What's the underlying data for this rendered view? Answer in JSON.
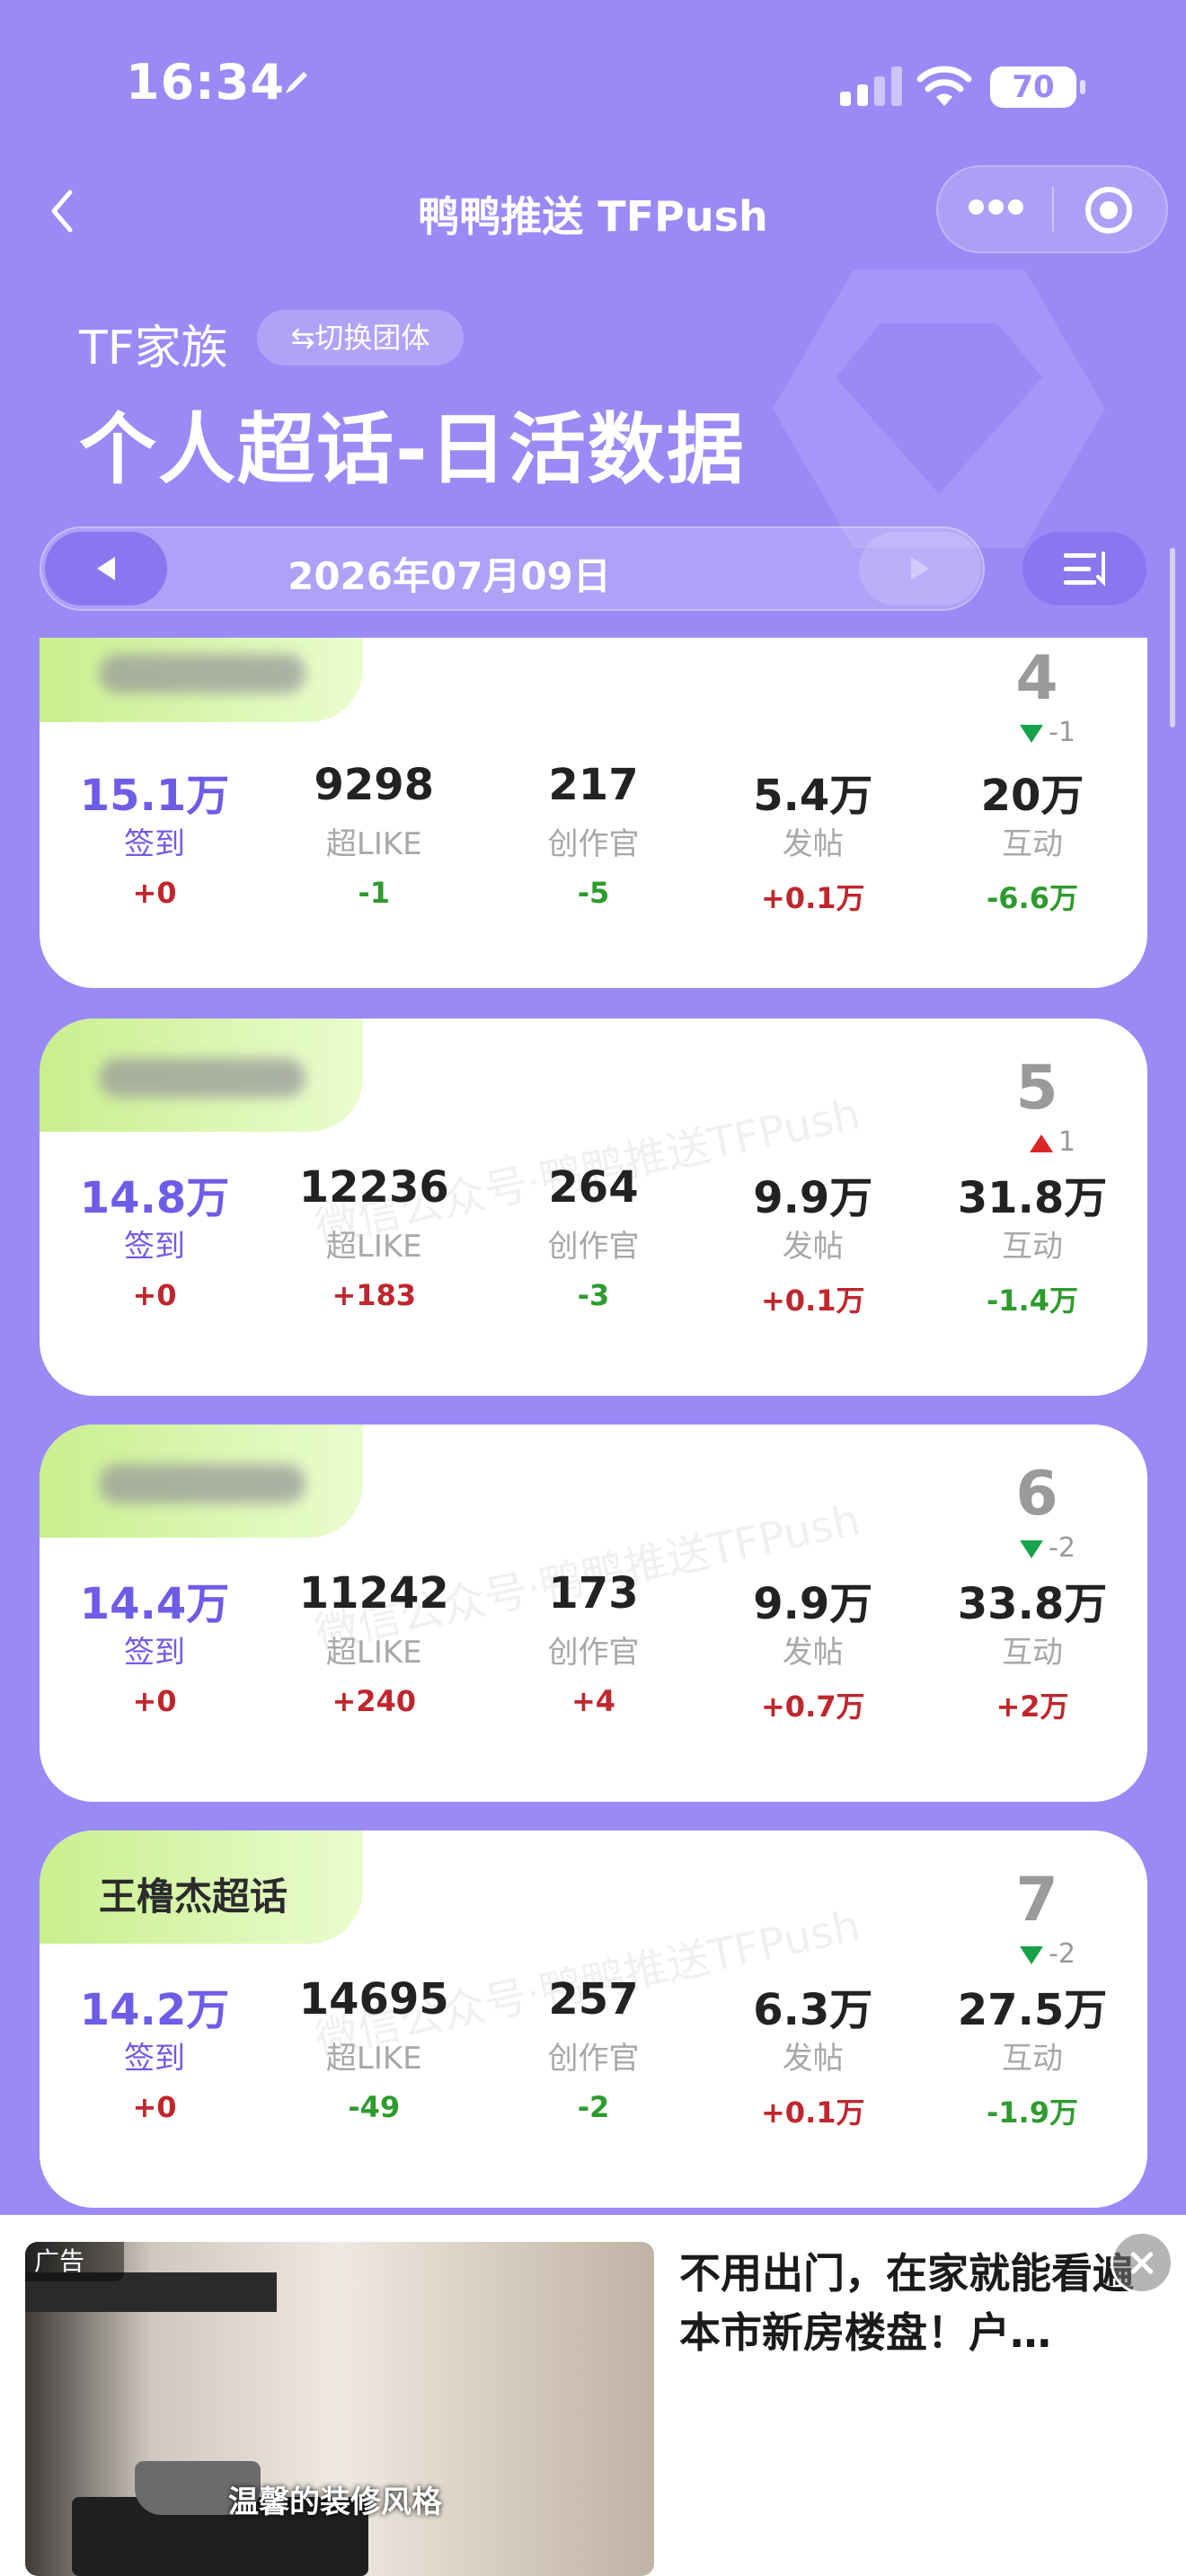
{
  "status_bar": {
    "time": "16:34",
    "battery": "70"
  },
  "nav": {
    "title": "鸭鸭推送 TFPush"
  },
  "header": {
    "family": "TF家族",
    "switch_label": "⇆切换团体",
    "title": "个人超话-日活数据"
  },
  "date": {
    "text": "2026年07月09日"
  },
  "metric_labels": [
    "签到",
    "超LIKE",
    "创作官",
    "发帖",
    "互动"
  ],
  "watermark": "微信公众号·鸭鸭推送TFPush",
  "cards": [
    {
      "name": "",
      "blurred": true,
      "rank": "4",
      "rank_change": "-1",
      "rank_dir": "down",
      "values": [
        "15.1万",
        "9298",
        "217",
        "5.4万",
        "20万"
      ],
      "deltas": [
        "+0",
        "-1",
        "-5",
        "+0.1万",
        "-6.6万"
      ]
    },
    {
      "name": "",
      "blurred": true,
      "rank": "5",
      "rank_change": "1",
      "rank_dir": "up",
      "values": [
        "14.8万",
        "12236",
        "264",
        "9.9万",
        "31.8万"
      ],
      "deltas": [
        "+0",
        "+183",
        "-3",
        "+0.1万",
        "-1.4万"
      ]
    },
    {
      "name": "",
      "blurred": true,
      "rank": "6",
      "rank_change": "-2",
      "rank_dir": "down",
      "values": [
        "14.4万",
        "11242",
        "173",
        "9.9万",
        "33.8万"
      ],
      "deltas": [
        "+0",
        "+240",
        "+4",
        "+0.7万",
        "+2万"
      ]
    },
    {
      "name": "王橹杰超话",
      "blurred": false,
      "rank": "7",
      "rank_change": "-2",
      "rank_dir": "down",
      "values": [
        "14.2万",
        "14695",
        "257",
        "6.3万",
        "27.5万"
      ],
      "deltas": [
        "+0",
        "-49",
        "-2",
        "+0.1万",
        "-1.9万"
      ]
    }
  ],
  "ad": {
    "label": "广告",
    "caption": "温馨的装修风格",
    "text": "不用出门，在家就能看遍本市新房楼盘！户…"
  },
  "colors": {
    "background": "#9a8af5",
    "accent": "#6f5ce6",
    "positive": "#c0262d",
    "negative": "#2e9b2e",
    "tag": "#c9ef8e"
  }
}
